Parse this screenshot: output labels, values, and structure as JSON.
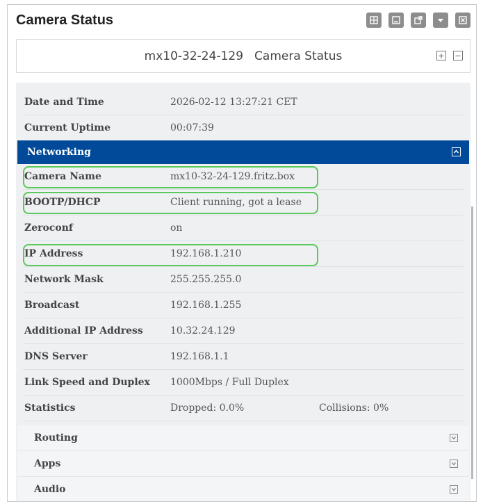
{
  "window": {
    "title": "Camera Status",
    "icons": [
      "layout-icon",
      "minimize-icon",
      "popout-icon",
      "collapse-icon",
      "close-icon"
    ]
  },
  "subheader": {
    "camera_name": "mx10-32-24-129",
    "label": "Camera Status",
    "expand_label": "+",
    "collapse_label": "−"
  },
  "status": {
    "rows": [
      {
        "label": "Date and Time",
        "value": "2026-02-12 13:27:21 CET"
      },
      {
        "label": "Current Uptime",
        "value": "00:07:39"
      }
    ]
  },
  "networking": {
    "title": "Networking",
    "rows": [
      {
        "label": "Camera Name",
        "value": "mx10-32-24-129.fritz.box"
      },
      {
        "label": "BOOTP/DHCP",
        "value": "Client running, got a lease"
      },
      {
        "label": "Zeroconf",
        "value": "on"
      },
      {
        "label": "IP Address",
        "value": "192.168.1.210"
      },
      {
        "label": "Network Mask",
        "value": "255.255.255.0"
      },
      {
        "label": "Broadcast",
        "value": "192.168.1.255"
      },
      {
        "label": "Additional IP Address",
        "value": "10.32.24.129"
      },
      {
        "label": "DNS Server",
        "value": "192.168.1.1"
      },
      {
        "label": "Link Speed and Duplex",
        "value": "1000Mbps / Full Duplex"
      },
      {
        "label": "Statistics",
        "value": "Dropped: 0.0%",
        "value2": "Collisions: 0%"
      }
    ]
  },
  "sections": [
    {
      "label": "Routing"
    },
    {
      "label": "Apps"
    },
    {
      "label": "Audio"
    }
  ],
  "colors": {
    "section_header": "#004a99",
    "highlight": "#5ac85a",
    "panel_bg": "#eef0f2"
  }
}
